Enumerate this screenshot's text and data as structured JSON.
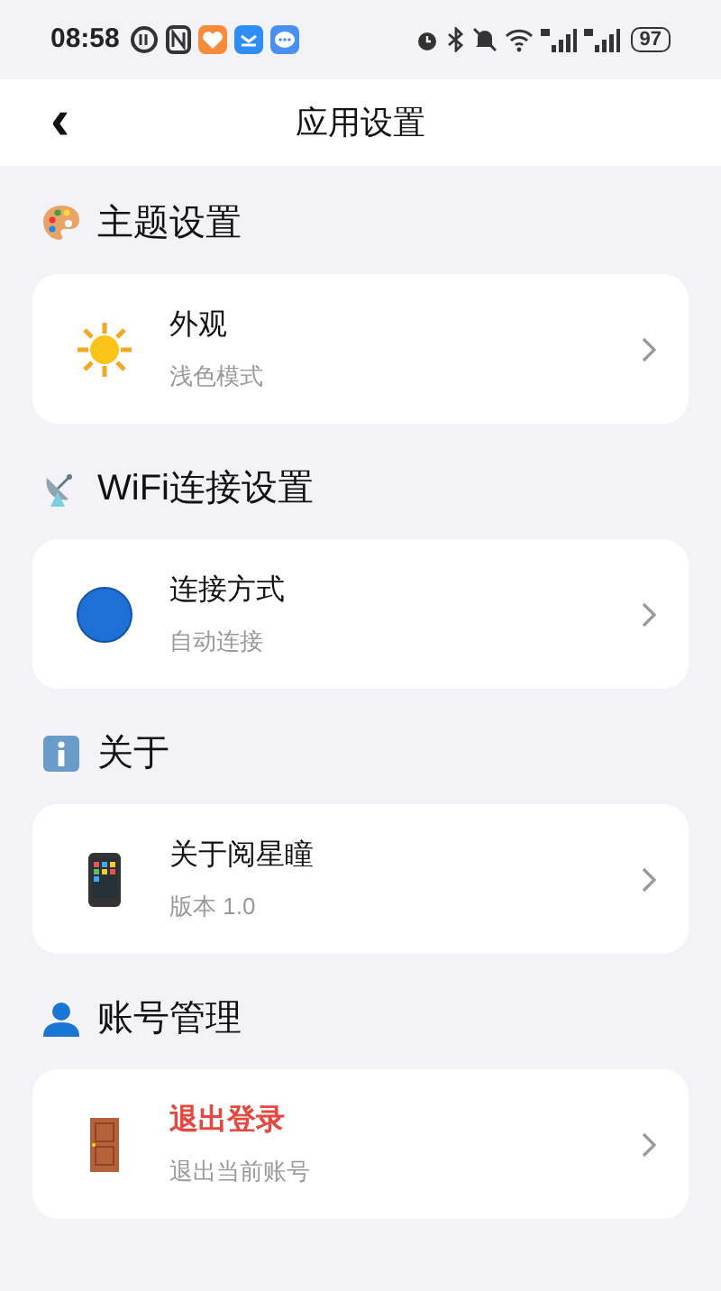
{
  "status_bar": {
    "time": "08:58",
    "battery": "97"
  },
  "header": {
    "back": "‹",
    "title": "应用设置"
  },
  "sections": [
    {
      "title": "主题设置",
      "items": [
        {
          "title": "外观",
          "subtitle": "浅色模式",
          "danger": false
        }
      ]
    },
    {
      "title": "WiFi连接设置",
      "items": [
        {
          "title": "连接方式",
          "subtitle": "自动连接",
          "danger": false
        }
      ]
    },
    {
      "title": "关于",
      "items": [
        {
          "title": "关于阅星瞳",
          "subtitle": "版本 1.0",
          "danger": false
        }
      ]
    },
    {
      "title": "账号管理",
      "items": [
        {
          "title": "退出登录",
          "subtitle": "退出当前账号",
          "danger": true
        }
      ]
    }
  ]
}
